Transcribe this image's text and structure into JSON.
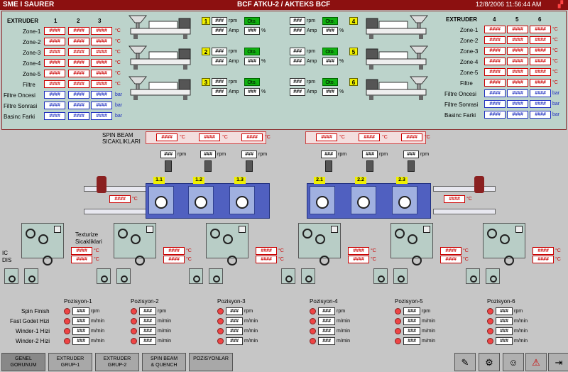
{
  "title": {
    "left": "SME I SAURER",
    "center": "BCF ATKU-2 / AKTEKS BCF",
    "datetime": "12/8/2006 11:56:44 AM"
  },
  "placeholder": {
    "red": "####",
    "black": "###"
  },
  "units": {
    "c": "°C",
    "bar": "bar",
    "rpm": "rpm",
    "amp": "Amp",
    "pct": "%",
    "mmin": "m/min"
  },
  "extruder_left": {
    "header": "EXTRUDER",
    "cols": [
      "1",
      "2",
      "3"
    ]
  },
  "extruder_right": {
    "header": "EXTRUDER",
    "cols": [
      "4",
      "5",
      "6"
    ]
  },
  "zones": [
    "Zone-1",
    "Zone-2",
    "Zone-3",
    "Zone-4",
    "Zone-5",
    "Filtre"
  ],
  "pressures": [
    "Filtre Oncesi",
    "Filtre Sonrasi",
    "Basinc Farki"
  ],
  "mode": "Oto.",
  "extruder_numbers_left": [
    "1",
    "2",
    "3"
  ],
  "extruder_numbers_right": [
    "4",
    "5",
    "6"
  ],
  "spin_beam": {
    "label_line1": "SPIN BEAM",
    "label_line2": "SICAKLIKLARI",
    "pumps_left": [
      "1.1",
      "1.2",
      "1.3"
    ],
    "pumps_right": [
      "2.1",
      "2.2",
      "2.3"
    ]
  },
  "texturize": {
    "label_line1": "Texturize",
    "label_line2": "Sicakliklari",
    "ic": "IC",
    "dis": "DIS"
  },
  "positions": [
    "Pozisyon-1",
    "Pozisyon-2",
    "Pozisyon-3",
    "Pozisyon-4",
    "Pozisyon-5",
    "Pozisyon-6"
  ],
  "position_rows": [
    {
      "label": "Spin Finish",
      "unit": "rpm"
    },
    {
      "label": "Fast Godet Hizi",
      "unit": "m/min"
    },
    {
      "label": "Winder-1 Hizi",
      "unit": "m/min"
    },
    {
      "label": "Winder-2 Hizi",
      "unit": "m/min"
    }
  ],
  "nav_buttons": [
    {
      "line1": "GENEL",
      "line2": "GORUNUM"
    },
    {
      "line1": "EXTRUDER",
      "line2": "GRUP-1"
    },
    {
      "line1": "EXTRUDER",
      "line2": "GRUP-2"
    },
    {
      "line1": "SPIN BEAM",
      "line2": "& QUENCH"
    },
    {
      "line1": "POZISYONLAR",
      "line2": ""
    }
  ],
  "tool_icons": [
    "edit-icon",
    "settings-gear-icon",
    "operator-icon",
    "alarm-warning-icon",
    "exit-icon"
  ],
  "colors": {
    "title_bg": "#8c1010",
    "panel_bg": "#bcd3cb",
    "value_red": "#cc0000",
    "value_blue": "#2030c0",
    "oto_green": "#10b010",
    "beam_blue": "#5060c0"
  }
}
